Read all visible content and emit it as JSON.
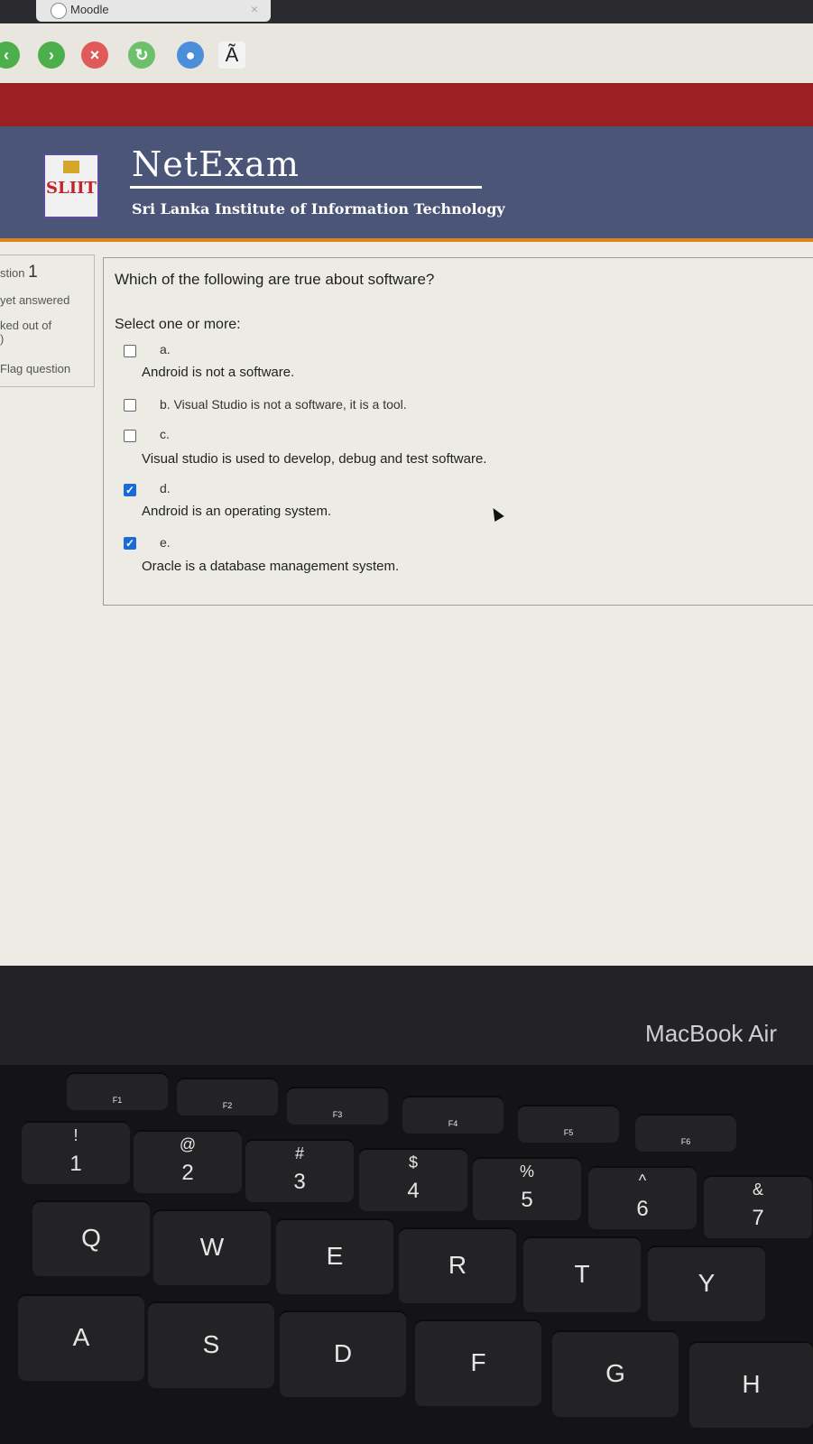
{
  "browser": {
    "tab_title": "Moodle",
    "font_button_label": "Ã"
  },
  "header": {
    "brand": "NetExam",
    "logo_text": "SLIIT",
    "institute": "Sri Lanka Institute of Information Technology"
  },
  "question_info": {
    "number_prefix": "stion",
    "number": "1",
    "status": "yet answered",
    "mark": "ked out of",
    "mark_value": ")",
    "flag": "Flag question"
  },
  "question": {
    "text": "Which of the following are true about software?",
    "prompt": "Select one or more:",
    "options": [
      {
        "letter": "a.",
        "text": "Android is not a software.",
        "checked": false
      },
      {
        "letter": "b. Visual Studio is not a software, it is a tool.",
        "text": "",
        "checked": false
      },
      {
        "letter": "c.",
        "text": "Visual studio is used to develop, debug and test software.",
        "checked": true
      },
      {
        "letter": "d.",
        "text": "Android is an operating system.",
        "checked": true
      },
      {
        "letter": "e.",
        "text": "Oracle is a database management system.",
        "checked": true
      }
    ]
  },
  "laptop": {
    "model": "MacBook Air",
    "fn_keys": [
      "F1",
      "F2",
      "F3",
      "F4",
      "F5",
      "F6"
    ],
    "number_keys": [
      {
        "top": "!",
        "bottom": "1"
      },
      {
        "top": "@",
        "bottom": "2"
      },
      {
        "top": "#",
        "bottom": "3"
      },
      {
        "top": "$",
        "bottom": "4"
      },
      {
        "top": "%",
        "bottom": "5"
      },
      {
        "top": "^",
        "bottom": "6"
      },
      {
        "top": "&",
        "bottom": "7"
      }
    ],
    "letter_row1": [
      "Q",
      "W",
      "E",
      "R",
      "T",
      "Y"
    ],
    "letter_row2": [
      "A",
      "S",
      "D",
      "F",
      "G",
      "H"
    ]
  }
}
